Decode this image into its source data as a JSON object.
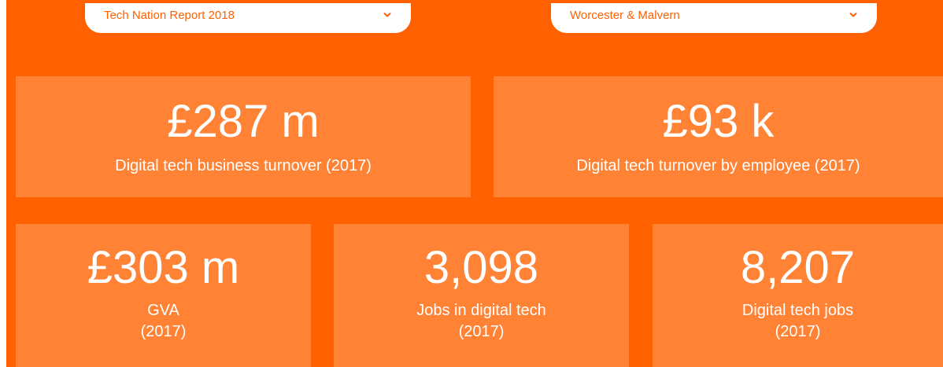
{
  "filters": {
    "report": {
      "value": "Tech Nation Report 2018",
      "icon": "chevron-down-icon"
    },
    "region": {
      "value": "Worcester & Malvern",
      "icon": "chevron-down-icon"
    }
  },
  "stats": {
    "turnover": {
      "value": "£287 m",
      "label": "Digital tech business turnover (2017)"
    },
    "turnover_per_employee": {
      "value": "£93 k",
      "label": "Digital tech turnover by employee (2017)"
    },
    "gva": {
      "value": "£303 m",
      "label": "GVA\n(2017)"
    },
    "jobs_in_digital_tech": {
      "value": "3,098",
      "label": "Jobs in digital tech\n(2017)"
    },
    "digital_tech_jobs": {
      "value": "8,207",
      "label": "Digital tech jobs\n(2017)"
    }
  },
  "colors": {
    "background": "#ff6000",
    "card": "#ff8235",
    "text": "#ffffff",
    "select_text": "#ff6000"
  }
}
